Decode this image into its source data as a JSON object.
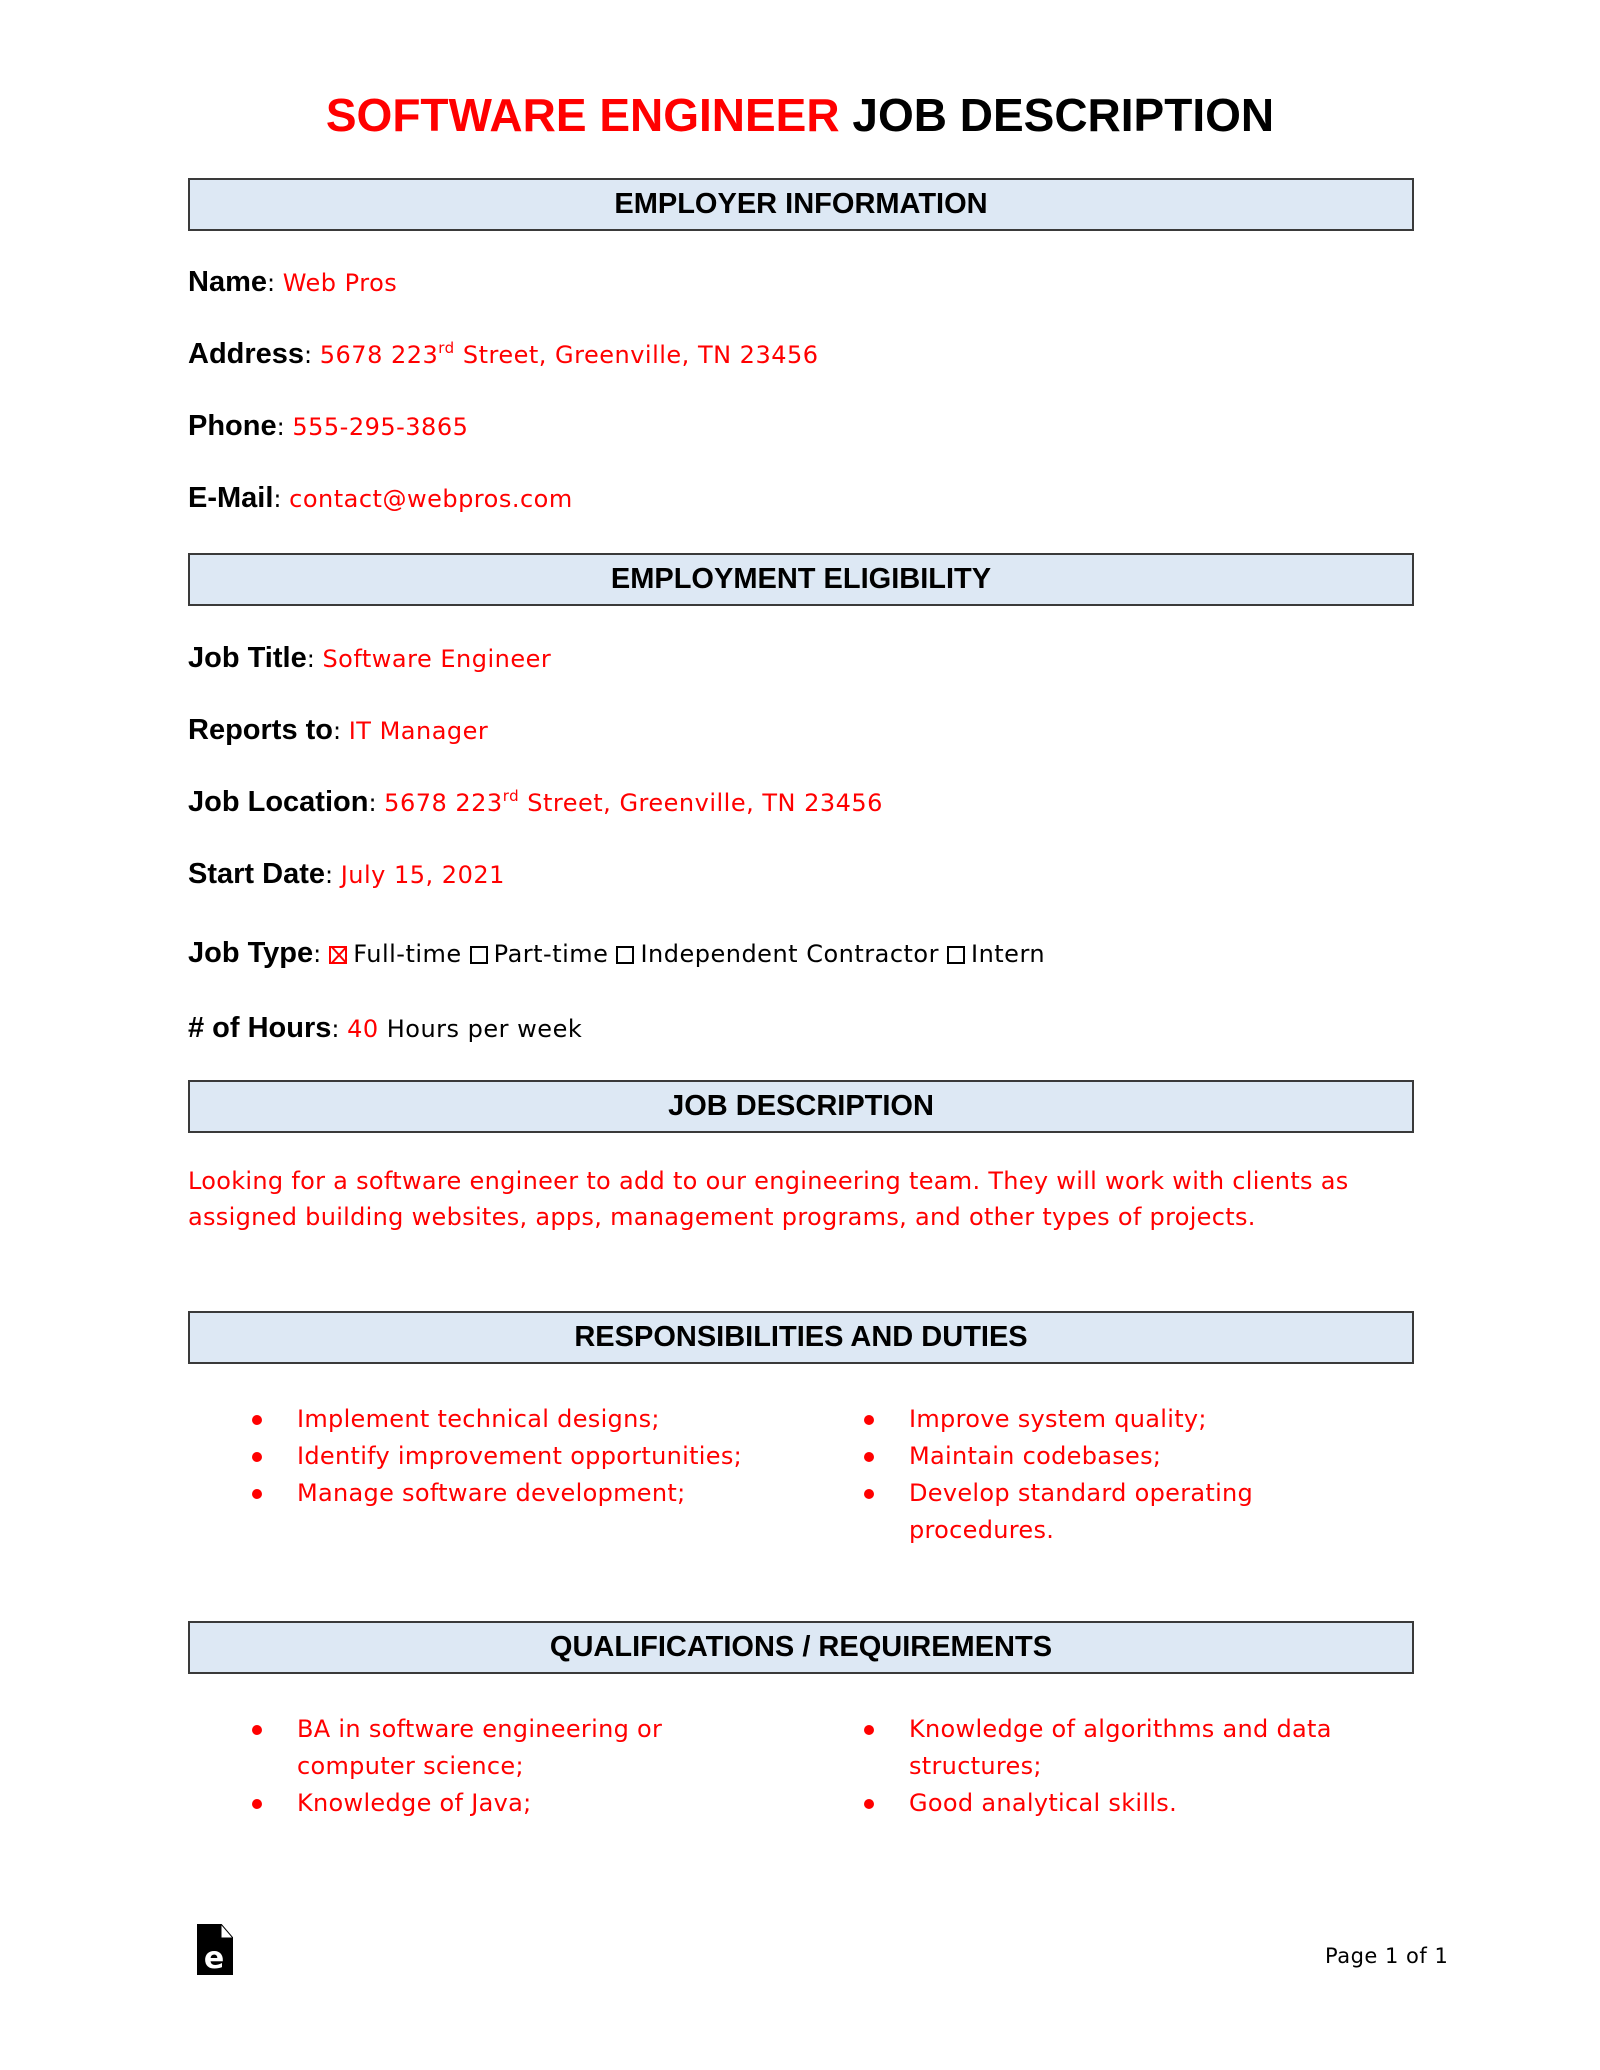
{
  "title": {
    "highlight": "SOFTWARE ENGINEER",
    "rest": "JOB DESCRIPTION"
  },
  "colors": {
    "accent": "#ff0000",
    "header_fill": "#dde8f4",
    "header_border": "#3a3a3a"
  },
  "sections": {
    "employer": {
      "heading": "EMPLOYER INFORMATION",
      "name": {
        "label": "Name",
        "value": "Web Pros"
      },
      "address": {
        "label": "Address",
        "value_pre": "5678 223",
        "value_sup": "rd",
        "value_post": " Street, Greenville, TN 23456"
      },
      "phone": {
        "label": "Phone",
        "value": "555-295-3865"
      },
      "email": {
        "label": "E-Mail",
        "value": "contact@webpros.com"
      }
    },
    "eligibility": {
      "heading": "EMPLOYMENT ELIGIBILITY",
      "job_title": {
        "label": "Job Title",
        "value": "Software Engineer"
      },
      "reports_to": {
        "label": "Reports to",
        "value": "IT Manager"
      },
      "job_location": {
        "label": "Job Location",
        "value_pre": "5678 223",
        "value_sup": "rd",
        "value_post": " Street, Greenville, TN 23456"
      },
      "start_date": {
        "label": "Start Date",
        "value": "July 15, 2021"
      },
      "job_type": {
        "label": "Job Type",
        "options": [
          {
            "label": "Full-time",
            "checked": true
          },
          {
            "label": "Part-time",
            "checked": false
          },
          {
            "label": "Independent Contractor",
            "checked": false
          },
          {
            "label": "Intern",
            "checked": false
          }
        ]
      },
      "hours": {
        "label": "# of Hours",
        "value": "40",
        "suffix": "Hours per week"
      }
    },
    "job_description": {
      "heading": "JOB DESCRIPTION",
      "text": "Looking for a software engineer to add to our engineering team. They will work with clients as assigned building websites, apps, management programs, and other types of projects."
    },
    "responsibilities": {
      "heading": "RESPONSIBILITIES AND DUTIES",
      "left": [
        "Implement technical designs;",
        "Identify improvement opportunities;",
        "Manage software development;"
      ],
      "right": [
        "Improve system quality;",
        "Maintain codebases;",
        "Develop standard operating procedures."
      ]
    },
    "qualifications": {
      "heading": "QUALIFICATIONS / REQUIREMENTS",
      "left": [
        "BA in software engineering or computer science;",
        "Knowledge of Java;"
      ],
      "right": [
        "Knowledge of algorithms and data structures;",
        "Good analytical skills."
      ]
    }
  },
  "footer": {
    "logo_icon": "eforms-document-icon",
    "page": "Page 1 of 1"
  }
}
